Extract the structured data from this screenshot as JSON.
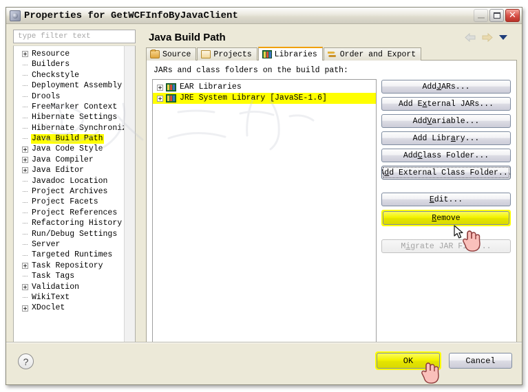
{
  "window": {
    "title": "Properties for GetWCFInfoByJavaClient",
    "icon": "properties-gear-icon",
    "buttons": {
      "minimize": "minimize-icon",
      "maximize": "maximize-icon",
      "close": "close-icon"
    }
  },
  "sidebar": {
    "filter": {
      "value": "",
      "placeholder": "type filter text"
    },
    "items": [
      {
        "label": "Resource",
        "expandable": true,
        "selected": false
      },
      {
        "label": "Builders",
        "expandable": false,
        "selected": false
      },
      {
        "label": "Checkstyle",
        "expandable": false,
        "selected": false
      },
      {
        "label": "Deployment Assembly",
        "expandable": false,
        "selected": false
      },
      {
        "label": "Drools",
        "expandable": false,
        "selected": false
      },
      {
        "label": "FreeMarker Context",
        "expandable": false,
        "selected": false
      },
      {
        "label": "Hibernate Settings",
        "expandable": false,
        "selected": false
      },
      {
        "label": "Hibernate Synchronizer",
        "expandable": false,
        "selected": false
      },
      {
        "label": "Java Build Path",
        "expandable": false,
        "selected": true
      },
      {
        "label": "Java Code Style",
        "expandable": true,
        "selected": false
      },
      {
        "label": "Java Compiler",
        "expandable": true,
        "selected": false
      },
      {
        "label": "Java Editor",
        "expandable": true,
        "selected": false
      },
      {
        "label": "Javadoc Location",
        "expandable": false,
        "selected": false
      },
      {
        "label": "Project Archives",
        "expandable": false,
        "selected": false
      },
      {
        "label": "Project Facets",
        "expandable": false,
        "selected": false
      },
      {
        "label": "Project References",
        "expandable": false,
        "selected": false
      },
      {
        "label": "Refactoring History",
        "expandable": false,
        "selected": false
      },
      {
        "label": "Run/Debug Settings",
        "expandable": false,
        "selected": false
      },
      {
        "label": "Server",
        "expandable": false,
        "selected": false
      },
      {
        "label": "Targeted Runtimes",
        "expandable": false,
        "selected": false
      },
      {
        "label": "Task Repository",
        "expandable": true,
        "selected": false
      },
      {
        "label": "Task Tags",
        "expandable": false,
        "selected": false
      },
      {
        "label": "Validation",
        "expandable": true,
        "selected": false
      },
      {
        "label": "WikiText",
        "expandable": false,
        "selected": false
      },
      {
        "label": "XDoclet",
        "expandable": true,
        "selected": false
      }
    ]
  },
  "page": {
    "title": "Java Build Path",
    "nav": {
      "back": "back-arrow-icon",
      "forward": "forward-arrow-icon",
      "menu": "chevron-down-icon"
    }
  },
  "tabs": [
    {
      "label": "Source",
      "icon": "source-folder-icon",
      "active": false
    },
    {
      "label": "Projects",
      "icon": "projects-folder-icon",
      "active": false
    },
    {
      "label": "Libraries",
      "icon": "libraries-books-icon",
      "active": true
    },
    {
      "label": "Order and Export",
      "icon": "order-export-arrows-icon",
      "active": false
    }
  ],
  "libraries_tab": {
    "description": "JARs and class folders on the build path:",
    "entries": [
      {
        "label": "EAR Libraries",
        "expandable": true,
        "selected": false,
        "icon": "library-books-icon"
      },
      {
        "label": "JRE System Library [JavaSE-1.6]",
        "expandable": true,
        "selected": true,
        "icon": "library-books-icon"
      }
    ],
    "buttons": [
      {
        "label": "Add JARs...",
        "mnemonic": "J",
        "state": "normal",
        "highlight": false
      },
      {
        "label": "Add External JARs...",
        "mnemonic": "x",
        "state": "normal",
        "highlight": false
      },
      {
        "label": "Add Variable...",
        "mnemonic": "V",
        "state": "normal",
        "highlight": false
      },
      {
        "label": "Add Library...",
        "mnemonic": "a",
        "state": "normal",
        "highlight": false
      },
      {
        "label": "Add Class Folder...",
        "mnemonic": "C",
        "state": "normal",
        "highlight": false
      },
      {
        "label": "Add External Class Folder...",
        "mnemonic": "d",
        "state": "focused",
        "highlight": false
      },
      {
        "label": "Edit...",
        "mnemonic": "E",
        "state": "normal",
        "highlight": false,
        "gap_before": true
      },
      {
        "label": "Remove",
        "mnemonic": "R",
        "state": "normal",
        "highlight": true
      },
      {
        "label": "Migrate JAR File...",
        "mnemonic": "i",
        "state": "disabled",
        "highlight": false,
        "gap_before": true
      }
    ]
  },
  "footer": {
    "help": "?",
    "ok_label": "OK",
    "cancel_label": "Cancel",
    "ok_highlight": true
  },
  "colors": {
    "highlight_yellow": "#ffff00",
    "dialog_bg": "#ece9d8",
    "active_tab_accent": "#f0a000",
    "close_button_red": "#b93228",
    "panel_white": "#ffffff"
  },
  "cursors": [
    {
      "name": "remove-button-cursor",
      "type": "arrow-with-hand"
    },
    {
      "name": "ok-button-cursor",
      "type": "hand"
    }
  ]
}
